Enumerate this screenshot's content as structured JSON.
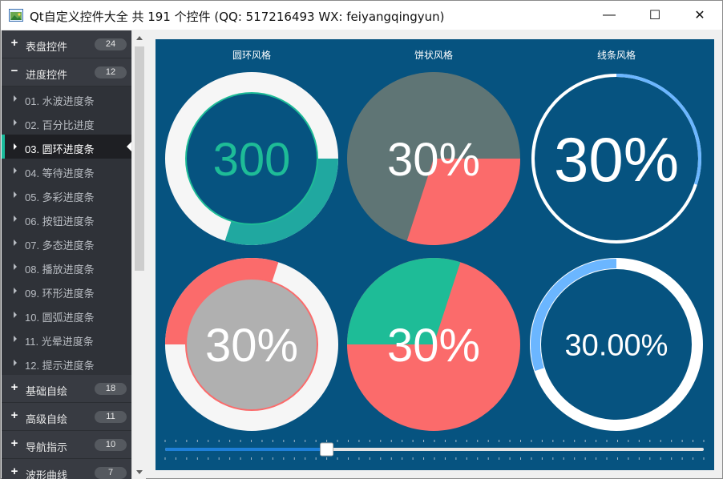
{
  "window": {
    "title": "Qt自定义控件大全 共 191 个控件 (QQ: 517216493 WX: feiyangqingyun)",
    "min_glyph": "—",
    "max_glyph": "☐",
    "close_glyph": "✕"
  },
  "sidebar": {
    "groups_top": [
      {
        "sign": "+",
        "label": "表盘控件",
        "count": "24"
      },
      {
        "sign": "−",
        "label": "进度控件",
        "count": "12"
      }
    ],
    "items": [
      {
        "label": "01. 水波进度条"
      },
      {
        "label": "02. 百分比进度"
      },
      {
        "label": "03. 圆环进度条"
      },
      {
        "label": "04. 等待进度条"
      },
      {
        "label": "05. 多彩进度条"
      },
      {
        "label": "06. 按钮进度条"
      },
      {
        "label": "07. 多态进度条"
      },
      {
        "label": "08. 播放进度条"
      },
      {
        "label": "09. 环形进度条"
      },
      {
        "label": "10. 圆弧进度条"
      },
      {
        "label": "11. 光晕进度条"
      },
      {
        "label": "12. 提示进度条"
      }
    ],
    "groups_bottom": [
      {
        "sign": "+",
        "label": "基础自绘",
        "count": "18"
      },
      {
        "sign": "+",
        "label": "高级自绘",
        "count": "11"
      },
      {
        "sign": "+",
        "label": "导航指示",
        "count": "10"
      },
      {
        "sign": "+",
        "label": "波形曲线",
        "count": "7"
      }
    ]
  },
  "content": {
    "headers": [
      "圆环风格",
      "饼状风格",
      "线条风格"
    ],
    "progress": 0.3,
    "widgets": [
      {
        "value_text": "300"
      },
      {
        "value_text": "30%"
      },
      {
        "value_text": "30%"
      },
      {
        "value_text": "30%"
      },
      {
        "value_text": "30%"
      },
      {
        "value_text": "30.00%"
      }
    ],
    "slider": {
      "value_fraction": 0.3
    },
    "colors": {
      "background": "#065380",
      "teal": "#1ebc97",
      "teal_dark": "#20a8a0",
      "coral": "#fb6b6b",
      "gray": "#5f7575",
      "light_gray": "#b0b0b0",
      "white": "#f6f6f6",
      "blue": "#6bb6ff",
      "slider_blue": "#1e7fd8"
    }
  }
}
